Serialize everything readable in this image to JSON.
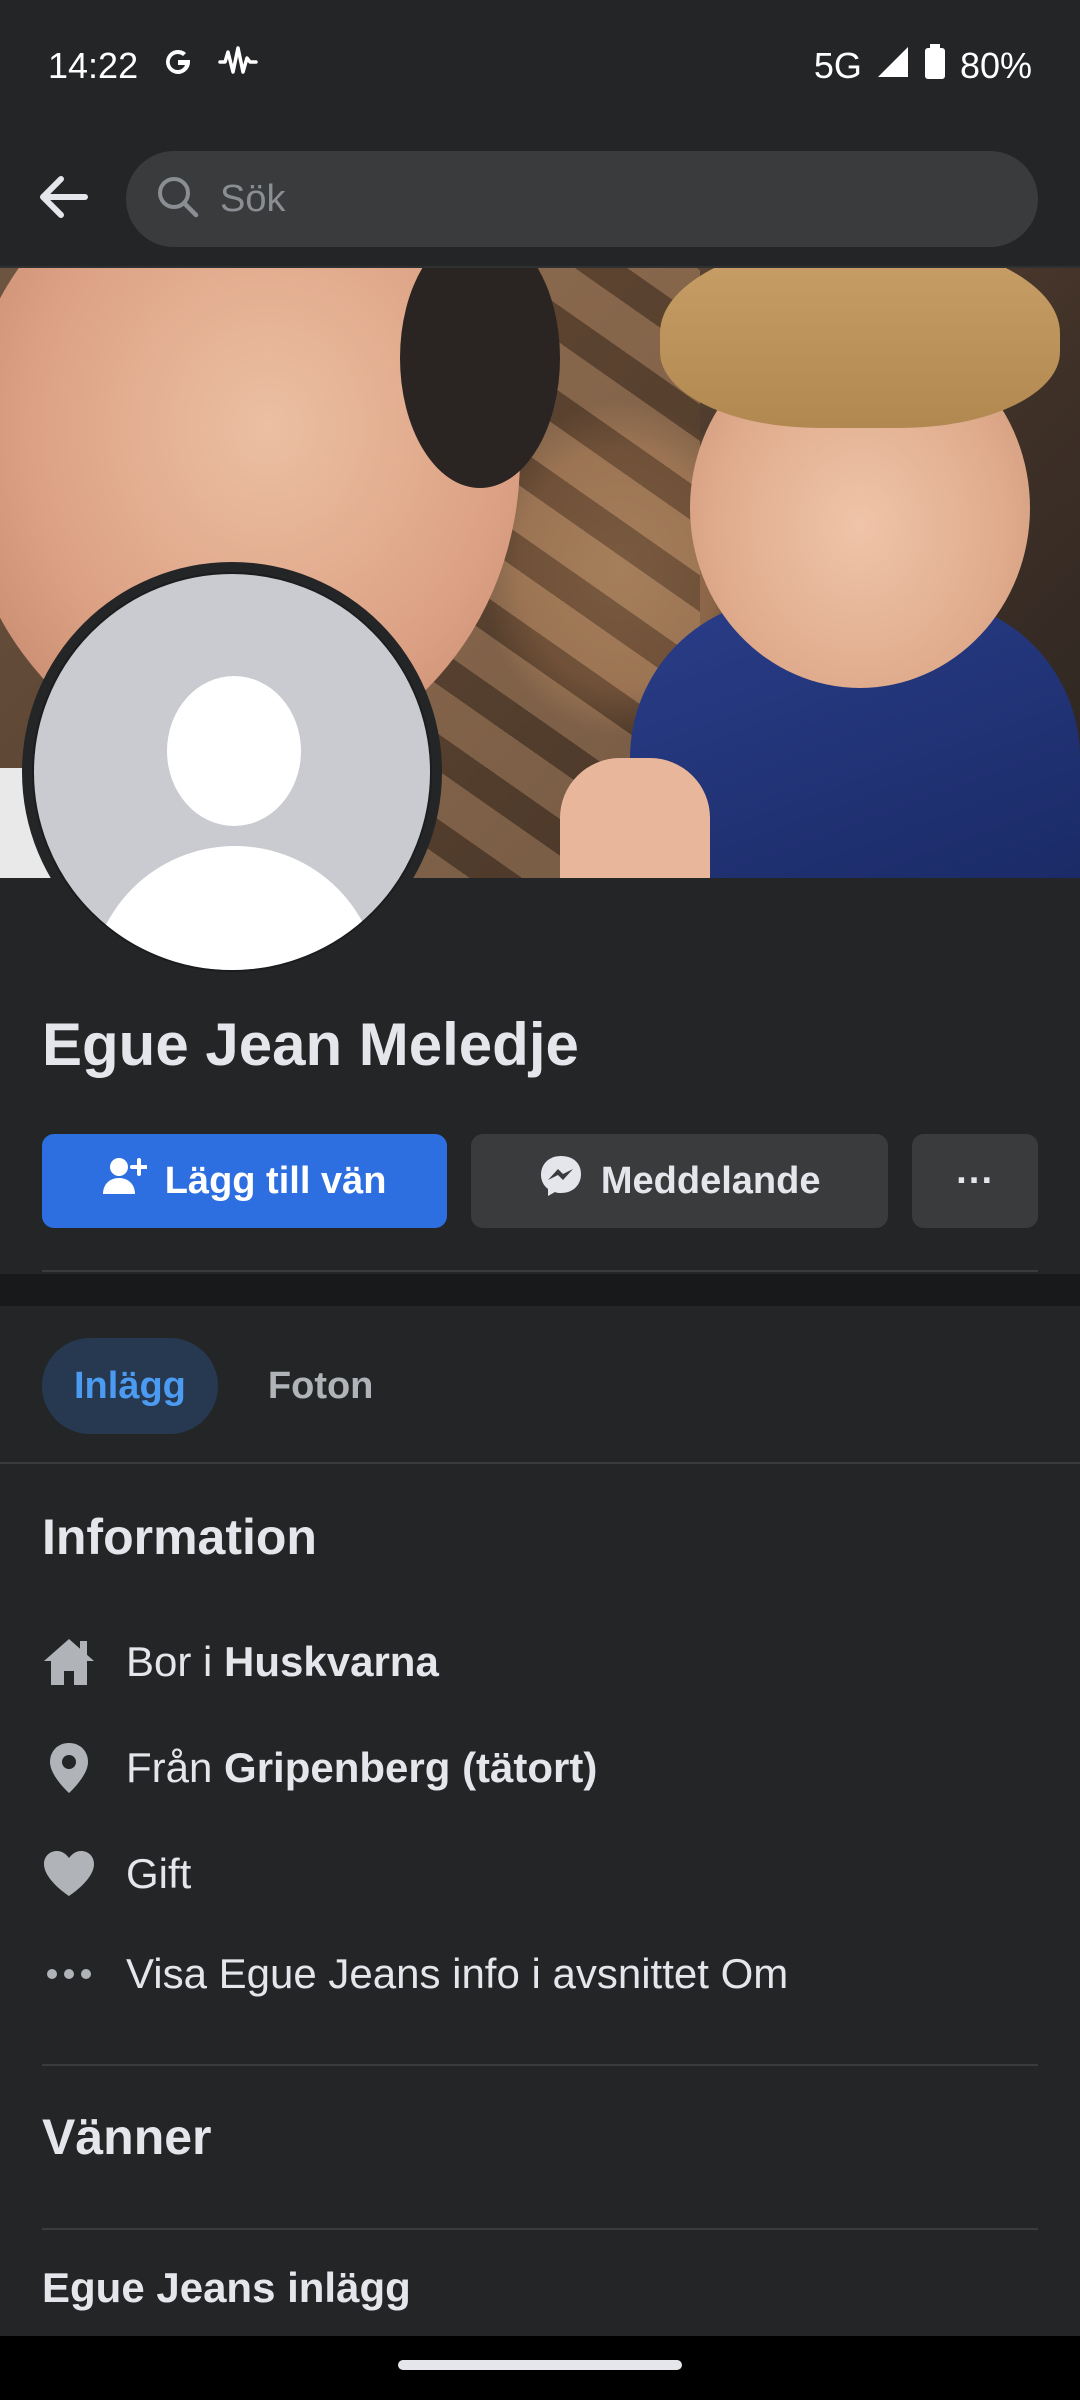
{
  "status_bar": {
    "time": "14:22",
    "network": "5G",
    "battery": "80%",
    "icons": [
      "google-icon",
      "sound-wave-icon",
      "signal-icon",
      "battery-icon"
    ]
  },
  "search": {
    "placeholder": "Sök"
  },
  "profile": {
    "name": "Egue Jean Meledje"
  },
  "actions": {
    "add_friend": "Lägg till vän",
    "message": "Meddelande",
    "more": "···"
  },
  "tabs": [
    {
      "label": "Inlägg",
      "active": true
    },
    {
      "label": "Foton",
      "active": false
    }
  ],
  "information": {
    "title": "Information",
    "lives_prefix": "Bor i",
    "lives_place": "Huskvarna",
    "from_prefix": "Från",
    "from_place": "Gripenberg (tätort)",
    "relationship": "Gift",
    "more_info": "Visa Egue Jeans info i avsnittet Om"
  },
  "friends": {
    "title": "Vänner"
  },
  "posts": {
    "title": "Egue Jeans inlägg"
  },
  "colors": {
    "background": "#242526",
    "primary_button": "#2d6fe0",
    "secondary_button": "#3a3b3c",
    "active_tab_bg": "#263951",
    "active_tab_text": "#4b9bf2"
  }
}
